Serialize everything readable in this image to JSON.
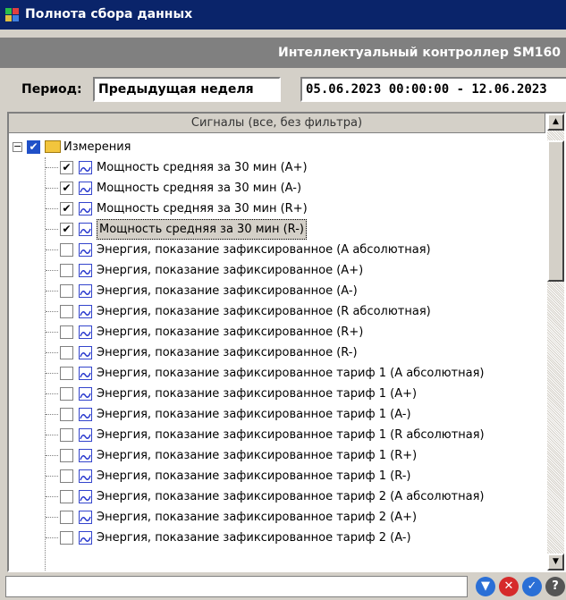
{
  "window": {
    "title": "Полнота сбора данных"
  },
  "header": {
    "device": "Интеллектуальный контроллер SM160"
  },
  "period": {
    "label": "Период:",
    "selected": "Предыдущая неделя",
    "range": "05.06.2023 00:00:00 - 12.06.2023"
  },
  "tree": {
    "column_header": "Сигналы (все, без фильтра)",
    "root": {
      "label": "Измерения",
      "checked": true
    },
    "items": [
      {
        "label": "Мощность средняя за 30 мин (A+)",
        "checked": true
      },
      {
        "label": "Мощность средняя за 30 мин (A-)",
        "checked": true
      },
      {
        "label": "Мощность средняя за 30 мин (R+)",
        "checked": true
      },
      {
        "label": "Мощность средняя за 30 мин (R-)",
        "checked": true,
        "selected": true
      },
      {
        "label": "Энергия, показание зафиксированное (A абсолютная)",
        "checked": false
      },
      {
        "label": "Энергия, показание зафиксированное (A+)",
        "checked": false
      },
      {
        "label": "Энергия, показание зафиксированное (A-)",
        "checked": false
      },
      {
        "label": "Энергия, показание зафиксированное (R абсолютная)",
        "checked": false
      },
      {
        "label": "Энергия, показание зафиксированное (R+)",
        "checked": false
      },
      {
        "label": "Энергия, показание зафиксированное (R-)",
        "checked": false
      },
      {
        "label": "Энергия, показание зафиксированное тариф 1 (A абсолютная)",
        "checked": false
      },
      {
        "label": "Энергия, показание зафиксированное тариф 1 (A+)",
        "checked": false
      },
      {
        "label": "Энергия, показание зафиксированное тариф 1 (A-)",
        "checked": false
      },
      {
        "label": "Энергия, показание зафиксированное тариф 1 (R абсолютная)",
        "checked": false
      },
      {
        "label": "Энергия, показание зафиксированное тариф 1 (R+)",
        "checked": false
      },
      {
        "label": "Энергия, показание зафиксированное тариф 1 (R-)",
        "checked": false
      },
      {
        "label": "Энергия, показание зафиксированное тариф 2 (A абсолютная)",
        "checked": false
      },
      {
        "label": "Энергия, показание зафиксированное тариф 2 (A+)",
        "checked": false
      },
      {
        "label": "Энергия, показание зафиксированное тариф 2 (A-)",
        "checked": false
      }
    ]
  },
  "statusbar": {
    "buttons": [
      {
        "icon": "filter-icon",
        "color": "#2a6fd6"
      },
      {
        "icon": "close-icon",
        "color": "#d62a2a"
      },
      {
        "icon": "check-icon",
        "color": "#2a6fd6"
      },
      {
        "icon": "help-icon",
        "color": "#555555"
      }
    ]
  }
}
